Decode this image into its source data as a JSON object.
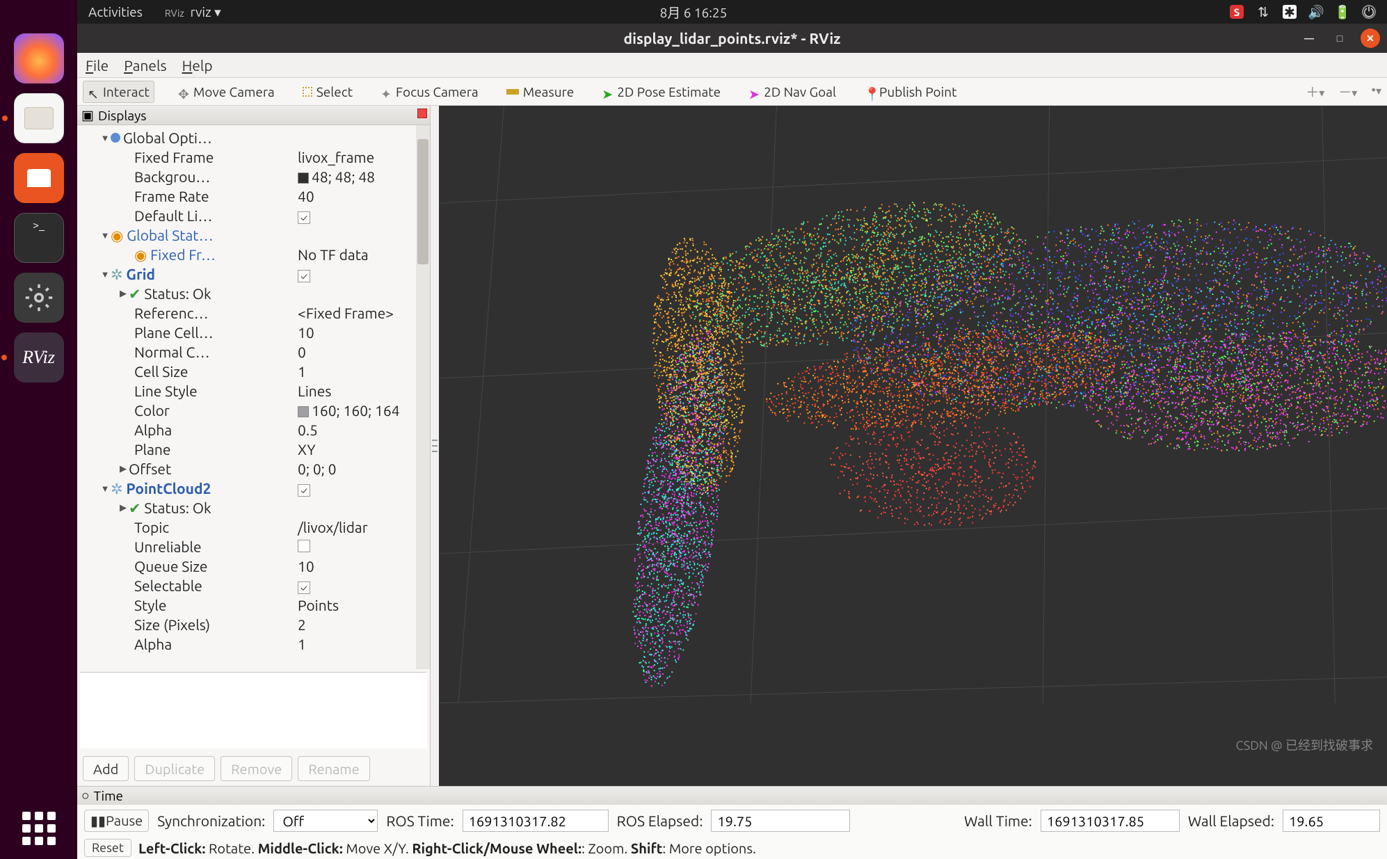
{
  "topbar": {
    "activities": "Activities",
    "app": "rviz ▾",
    "appPrefix": "RViz",
    "datetime": "8月 6  16:25"
  },
  "titlebar": {
    "title": "display_lidar_points.rviz* - RViz"
  },
  "menubar": {
    "file": "File",
    "panels": "Panels",
    "help": "Help"
  },
  "toolbar": {
    "interact": "Interact",
    "move": "Move Camera",
    "select": "Select",
    "focus": "Focus Camera",
    "measure": "Measure",
    "pose": "2D Pose Estimate",
    "nav": "2D Nav Goal",
    "publish": "Publish Point"
  },
  "displays": {
    "header": "Displays",
    "globalOptions": "Global Opti…",
    "fixedFrame": {
      "lbl": "Fixed Frame",
      "val": "livox_frame"
    },
    "background": {
      "lbl": "Backgrou…",
      "val": "48; 48; 48",
      "sw": "#303030"
    },
    "frameRate": {
      "lbl": "Frame Rate",
      "val": "40"
    },
    "defaultLight": {
      "lbl": "Default Li…",
      "val": "✓"
    },
    "globalStatus": "Global Stat…",
    "fixedFrStatus": {
      "lbl": "Fixed Fr…",
      "val": "No TF data"
    },
    "grid": "Grid",
    "gridChk": "✓",
    "statusOk": "Status: Ok",
    "reference": {
      "lbl": "Referenc…",
      "val": "<Fixed Frame>"
    },
    "planeCell": {
      "lbl": "Plane Cell…",
      "val": "10"
    },
    "normalC": {
      "lbl": "Normal C…",
      "val": "0"
    },
    "cellSize": {
      "lbl": "Cell Size",
      "val": "1"
    },
    "lineStyle": {
      "lbl": "Line Style",
      "val": "Lines"
    },
    "gridColor": {
      "lbl": "Color",
      "val": "160; 160; 164",
      "sw": "#a0a0a4"
    },
    "gridAlpha": {
      "lbl": "Alpha",
      "val": "0.5"
    },
    "plane": {
      "lbl": "Plane",
      "val": "XY"
    },
    "offset": {
      "lbl": "Offset",
      "val": "0; 0; 0"
    },
    "pc2": "PointCloud2",
    "pc2Chk": "✓",
    "topic": {
      "lbl": "Topic",
      "val": "/livox/lidar"
    },
    "unreliable": {
      "lbl": "Unreliable",
      "val": ""
    },
    "queue": {
      "lbl": "Queue Size",
      "val": "10"
    },
    "selectable": {
      "lbl": "Selectable",
      "val": "✓"
    },
    "style": {
      "lbl": "Style",
      "val": "Points"
    },
    "sizePx": {
      "lbl": "Size (Pixels)",
      "val": "2"
    },
    "alpha": {
      "lbl": "Alpha",
      "val": "1"
    },
    "add": "Add",
    "dup": "Duplicate",
    "rem": "Remove",
    "ren": "Rename"
  },
  "time": {
    "header": "Time",
    "pause": "Pause",
    "sync": "Synchronization:",
    "syncVal": "Off",
    "rosTime": "ROS Time:",
    "rosTimeVal": "1691310317.82",
    "rosElapsed": "ROS Elapsed:",
    "rosElapsedVal": "19.75",
    "wallTime": "Wall Time:",
    "wallTimeVal": "1691310317.85",
    "wallElapsed": "Wall Elapsed:",
    "wallElapsedVal": "19.65"
  },
  "hint": {
    "reset": "Reset",
    "t1": "Left-Click:",
    "v1": " Rotate. ",
    "t2": "Middle-Click:",
    "v2": " Move X/Y. ",
    "t3": "Right-Click/Mouse Wheel:",
    "v3": ": Zoom. ",
    "t4": "Shift",
    "v4": ": More options."
  },
  "watermark": "CSDN @ 已经到找破事求"
}
